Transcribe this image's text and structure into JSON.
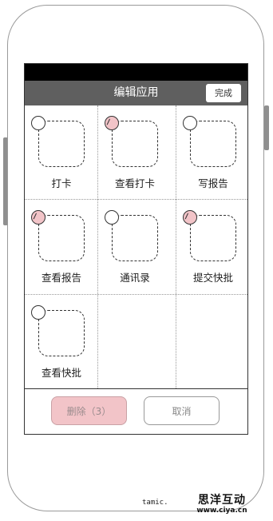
{
  "header": {
    "title": "编辑应用",
    "done_label": "完成"
  },
  "apps": [
    {
      "label": "打卡",
      "selected": false
    },
    {
      "label": "查看打卡",
      "selected": true
    },
    {
      "label": "写报告",
      "selected": false
    },
    {
      "label": "查看报告",
      "selected": true
    },
    {
      "label": "通讯录",
      "selected": false
    },
    {
      "label": "提交快批",
      "selected": true
    },
    {
      "label": "查看快批",
      "selected": false
    }
  ],
  "footer": {
    "delete_label": "删除（3）",
    "cancel_label": "取消"
  },
  "watermark": {
    "left_text": "tamic.",
    "brand": "思洋互动",
    "url": "www.ciya.cn"
  },
  "colors": {
    "header_bg": "#5f5f5f",
    "selected_badge": "#f2c4c8",
    "delete_btn_bg": "#f2c4c8"
  }
}
